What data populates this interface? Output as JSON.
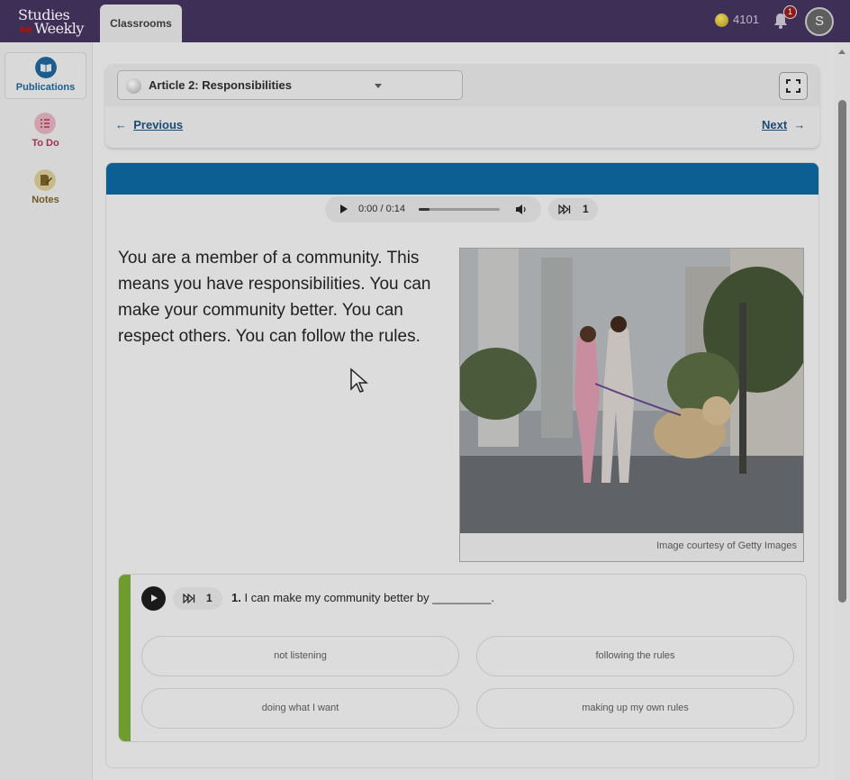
{
  "topbar": {
    "logo_line1": "Studies",
    "logo_line2": "Weekly",
    "tab_label": "Classrooms",
    "coins": "4101",
    "notification_count": "1",
    "avatar_initial": "S"
  },
  "sidebar": {
    "items": [
      {
        "label": "Publications",
        "icon": "book-icon",
        "color": "#1d5d8e"
      },
      {
        "label": "To Do",
        "icon": "checklist-icon",
        "color": "#a0324f"
      },
      {
        "label": "Notes",
        "icon": "notes-icon",
        "color": "#6f5a22"
      }
    ]
  },
  "article": {
    "selector_title": "Article 2: Responsibilities",
    "previous_label": "Previous",
    "next_label": "Next",
    "band_color": "#0b5f93",
    "audio_time": "0:00 / 0:14",
    "speed_label": "1",
    "body_text": "You are a member of a community. This means you have responsibilities. You can make your community better. You can respect others. You can follow the rules.",
    "image_caption": "Image courtesy of Getty Images"
  },
  "question": {
    "number": "1.",
    "text": "I can make my community better by _________.",
    "speed_label": "1",
    "accent_color": "#6e9c2e",
    "answers": [
      "not listening",
      "following the rules",
      "doing what I want",
      "making up my own rules"
    ]
  }
}
